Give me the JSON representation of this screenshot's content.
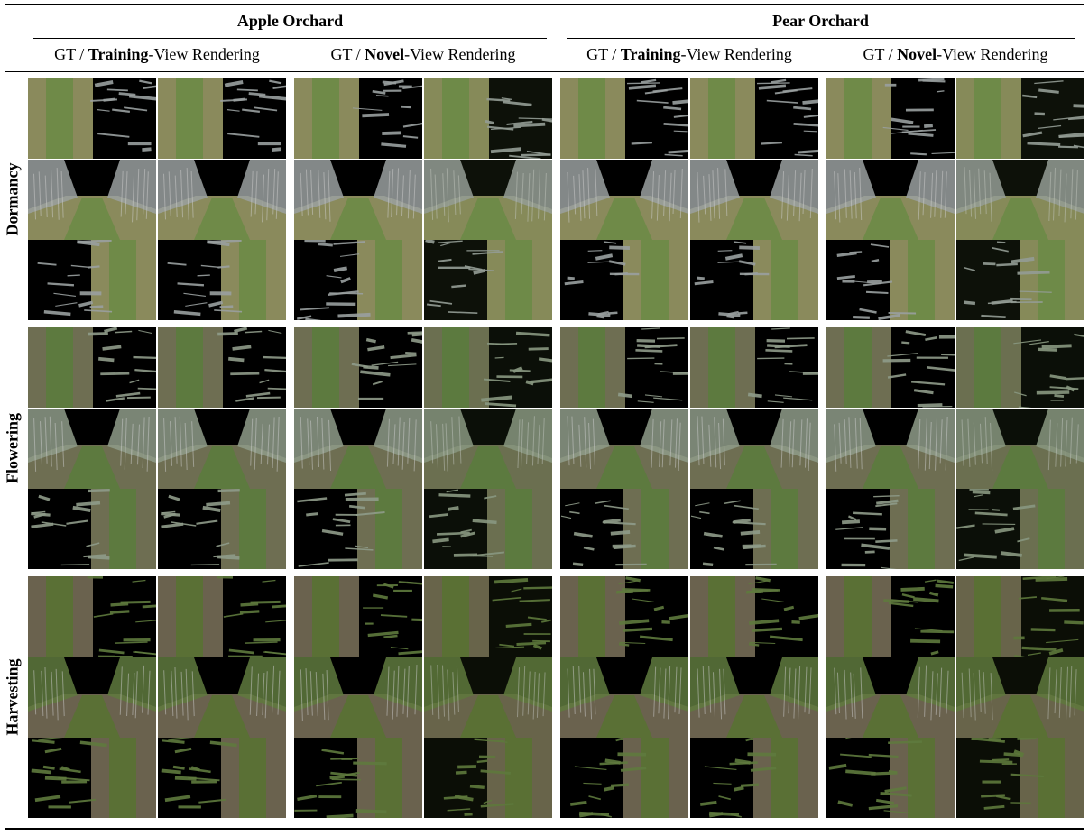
{
  "header": {
    "groups": [
      "Apple Orchard",
      "Pear Orchard"
    ],
    "columns": [
      {
        "pre": "GT / ",
        "bold": "Training",
        "post": "-View Rendering"
      },
      {
        "pre": "GT / ",
        "bold": "Novel",
        "post": "-View Rendering"
      },
      {
        "pre": "GT / ",
        "bold": "Training",
        "post": "-View Rendering"
      },
      {
        "pre": "GT / ",
        "bold": "Novel",
        "post": "-View Rendering"
      }
    ]
  },
  "rows": [
    "Dormancy",
    "Flowering",
    "Harvesting"
  ],
  "palettes": {
    "Dormancy": {
      "ground": "#8a8a5c",
      "grass": "#6f8a48",
      "foliage": "#9aa0a0",
      "sky": "#b9c0c4"
    },
    "Flowering": {
      "ground": "#6e6e52",
      "grass": "#5d7a3f",
      "foliage": "#8f9c8a",
      "sky": "#c2c7c8"
    },
    "Harvesting": {
      "ground": "#6a624e",
      "grass": "#5a7035",
      "foliage": "#5f7a3e",
      "sky": "#b8bcb0"
    }
  }
}
